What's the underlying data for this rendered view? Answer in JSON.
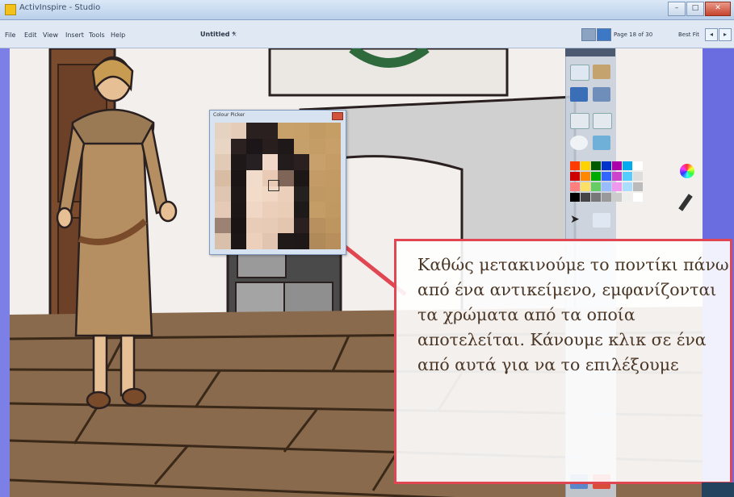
{
  "window": {
    "title": "ActivInspire - Studio"
  },
  "menu": {
    "file": "File",
    "edit": "Edit",
    "view": "View",
    "insert": "Insert",
    "tools": "Tools",
    "help": "Help"
  },
  "document": {
    "tab_label": "Untitled *",
    "tab_close": "×"
  },
  "navigation": {
    "page_label": "Page 18 of 30",
    "zoom_label": "Best Fit"
  },
  "color_picker": {
    "title": "Colour Picker",
    "grid": [
      [
        "#e6d2c0",
        "#e4ccb8",
        "#2a2020",
        "#2a2020",
        "#c8a06a",
        "#c79f68",
        "#c29a63",
        "#c59e66"
      ],
      [
        "#e8d5c3",
        "#2b2121",
        "#1d1618",
        "#281e1d",
        "#1e1818",
        "#c6a06b",
        "#c49c66",
        "#c89f68"
      ],
      [
        "#e2cbb6",
        "#1e1818",
        "#262022",
        "#f0d7c7",
        "#231c1d",
        "#2a2020",
        "#c8a06c",
        "#c59c66"
      ],
      [
        "#d8bca3",
        "#1b1516",
        "#f1dccb",
        "#e8cab5",
        "#7f6458",
        "#1c1616",
        "#c49b66",
        "#c39a64"
      ],
      [
        "#dfc6b2",
        "#1e1819",
        "#f2dbc9",
        "#f1d8c5",
        "#eccfba",
        "#252020",
        "#bf9863",
        "#c19a63"
      ],
      [
        "#e5cbb7",
        "#1d1718",
        "#f0d6c4",
        "#eccfbb",
        "#eacdb7",
        "#1f1a1a",
        "#c39c66",
        "#c09862"
      ],
      [
        "#9b8272",
        "#1a1415",
        "#e9ccb7",
        "#e8cbb6",
        "#e4c5b0",
        "#2a2020",
        "#b89060",
        "#bd965f"
      ],
      [
        "#d9c0ab",
        "#1c1617",
        "#ecd0bc",
        "#e2c5b0",
        "#1f1919",
        "#1e1818",
        "#b18a5a",
        "#b88f5c"
      ]
    ]
  },
  "palette_colors": [
    [
      "#ff3c00",
      "#ffd200",
      "#005a00",
      "#0033cc",
      "#aa00aa",
      "#00aaee",
      "#ffffff"
    ],
    [
      "#cc0000",
      "#ff8800",
      "#00aa00",
      "#3366ff",
      "#cc44cc",
      "#55ccff",
      "#dddddd"
    ],
    [
      "#ff7f7f",
      "#ffe066",
      "#66cc66",
      "#99bbff",
      "#ee99ee",
      "#aaddff",
      "#bbbbbb"
    ],
    [
      "#000000",
      "#444444",
      "#777777",
      "#999999",
      "#cccccc",
      "#eeeeee",
      "#ffffff"
    ]
  ],
  "callout": {
    "text": "Καθώς μετακινούμε το ποντίκι πάνω από ένα αντικείμενο, εμφανίζονται τα χρώματα από τα οποία αποτελείται. Κάνουμε κλικ σε ένα από αυτά για να το επιλέξουμε",
    "border_color": "#e04752"
  },
  "colors": {
    "desktop": "#6a6de0",
    "titlebar": "#b9cfe9",
    "floor": "#8a6a4d"
  }
}
